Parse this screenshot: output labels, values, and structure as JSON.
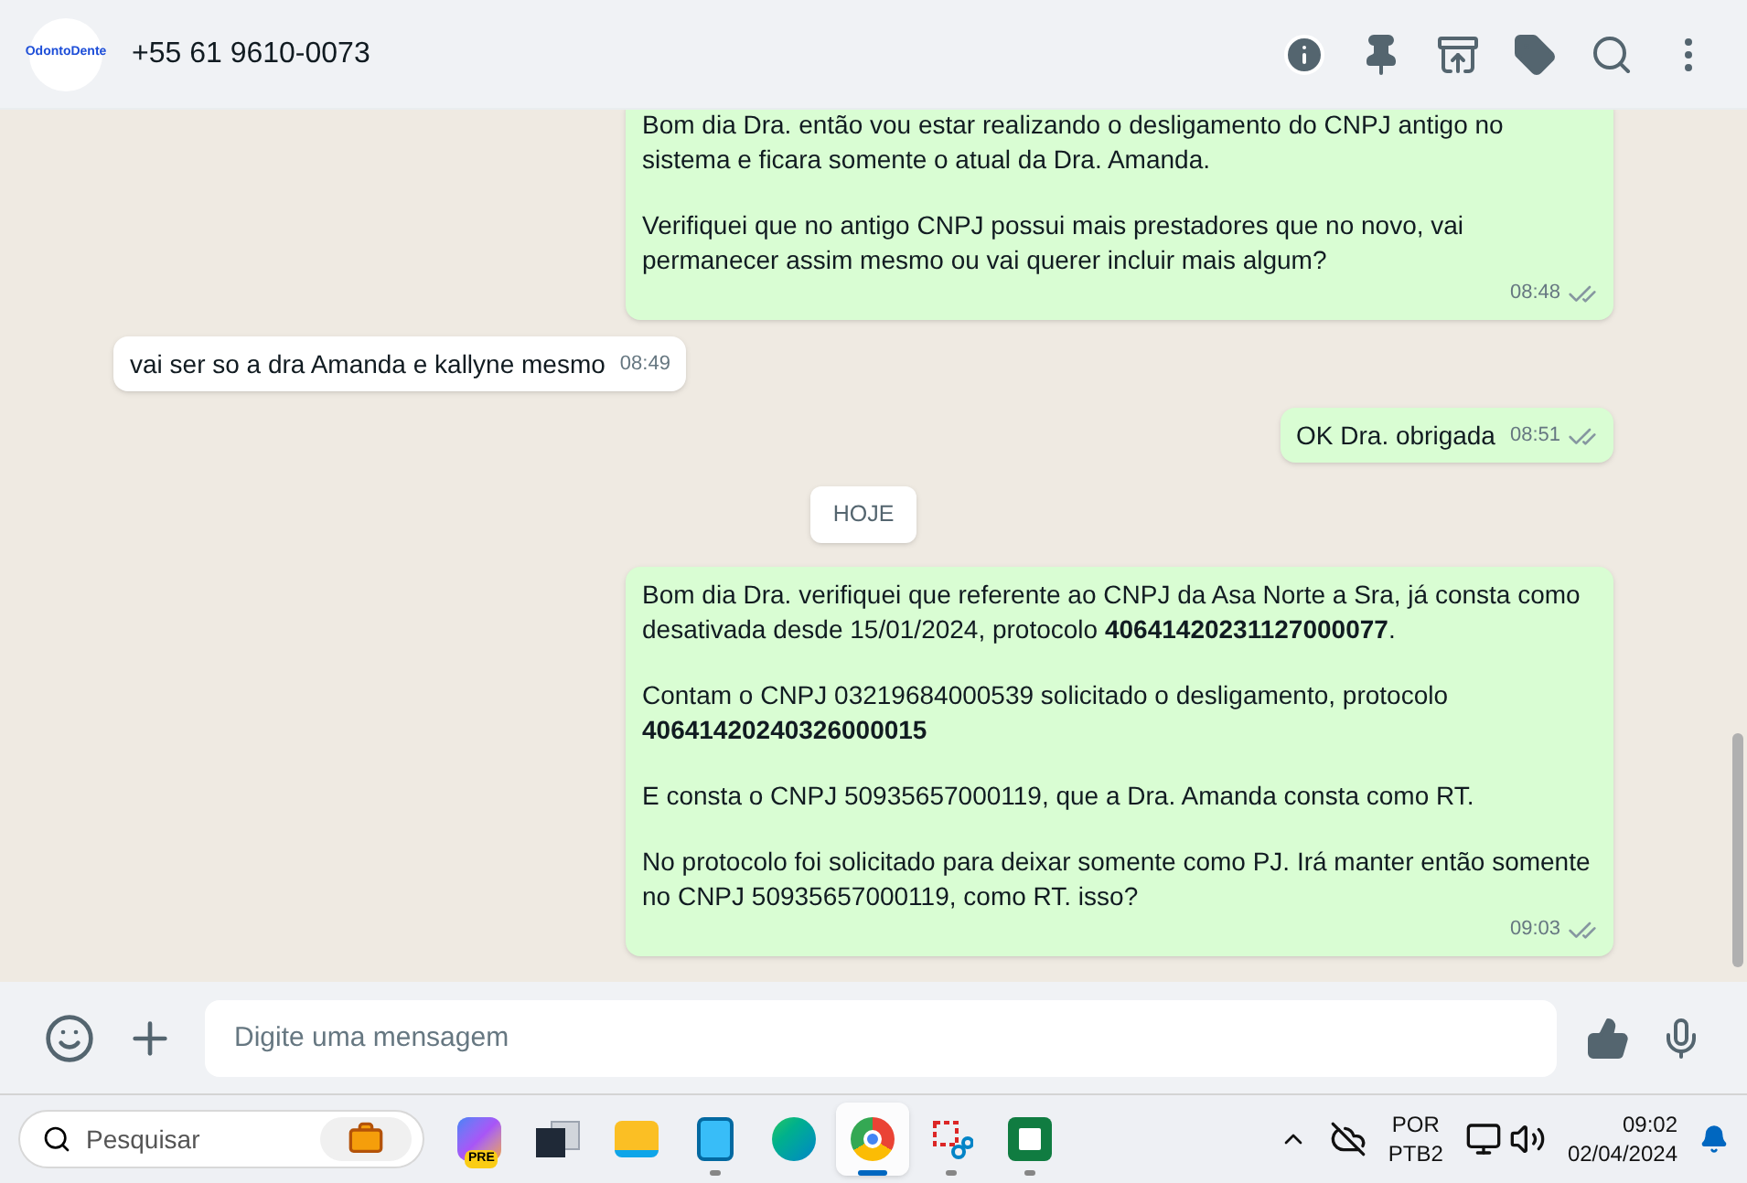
{
  "header": {
    "logo_text": "OdontoDente",
    "contact": "+55 61 9610-0073"
  },
  "messages": [
    {
      "kind": "out",
      "paragraphs": [
        "Bom dia Dra. então vou estar realizando o desligamento do CNPJ antigo no sistema e ficara somente o atual da Dra. Amanda.",
        "Verifiquei que no antigo CNPJ possui mais prestadores que no novo, vai permanecer assim mesmo ou vai querer incluir mais algum?"
      ],
      "time": "08:48",
      "read": false
    },
    {
      "kind": "in",
      "paragraphs": [
        "vai ser so a dra Amanda e kallyne mesmo"
      ],
      "time": "08:49"
    },
    {
      "kind": "out",
      "paragraphs": [
        "OK Dra. obrigada"
      ],
      "time": "08:51",
      "read": false
    },
    {
      "kind": "date",
      "label": "HOJE"
    },
    {
      "kind": "out",
      "paragraphs": [
        "Bom dia Dra. verifiquei que referente ao CNPJ da Asa Norte a Sra, já consta como desativada desde 15/01/2024, protocolo **40641420231127000077**.",
        "Contam o CNPJ 03219684000539 solicitado o desligamento, protocolo **40641420240326000015**",
        "E consta o CNPJ 50935657000119, que a Dra. Amanda consta como RT.",
        "No protocolo foi solicitado para deixar somente como PJ. Irá manter então somente no CNPJ 50935657000119, como RT. isso?"
      ],
      "time": "09:03",
      "read": false
    }
  ],
  "composer": {
    "placeholder": "Digite uma mensagem"
  },
  "taskbar": {
    "search_placeholder": "Pesquisar",
    "apps": [
      {
        "kind": "copilot",
        "badge": "PRE",
        "running": false,
        "selected": false
      },
      {
        "kind": "taskview",
        "running": false,
        "selected": false
      },
      {
        "kind": "folder",
        "running": false,
        "selected": false
      },
      {
        "kind": "notepad",
        "running": true,
        "selected": false
      },
      {
        "kind": "edge",
        "running": false,
        "selected": false
      },
      {
        "kind": "chrome",
        "running": true,
        "selected": true
      },
      {
        "kind": "snip",
        "running": true,
        "selected": false
      },
      {
        "kind": "excel",
        "running": true,
        "selected": false
      }
    ],
    "language": "POR",
    "layout": "PTB2",
    "time": "09:02",
    "date": "02/04/2024"
  }
}
